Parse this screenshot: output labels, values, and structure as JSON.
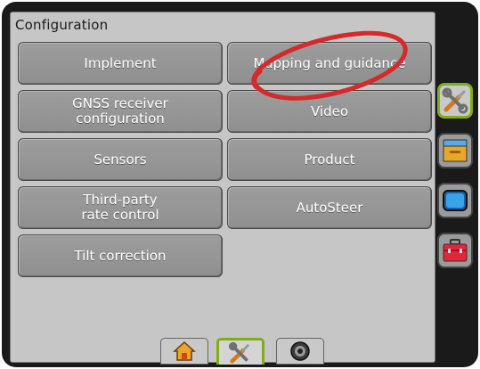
{
  "panel": {
    "title": "Configuration"
  },
  "buttons": {
    "implement": "Implement",
    "mapping": "Mapping and guidance",
    "gnss_line1": "GNSS receiver",
    "gnss_line2": "configuration",
    "video": "Video",
    "sensors": "Sensors",
    "product": "Product",
    "thirdparty_line1": "Third-party",
    "thirdparty_line2": "rate control",
    "autosteer": "AutoSteer",
    "tilt": "Tilt correction"
  },
  "side_tabs": [
    "wrench-screwdriver-icon",
    "console-icon",
    "monitor-icon",
    "toolbox-icon"
  ],
  "bottom_tabs": [
    "home-icon",
    "tools-icon",
    "camera-icon"
  ],
  "colors": {
    "active_tab_border": "#7fae1a",
    "highlight_circle": "#d42a2a",
    "button_face": "#979797"
  }
}
